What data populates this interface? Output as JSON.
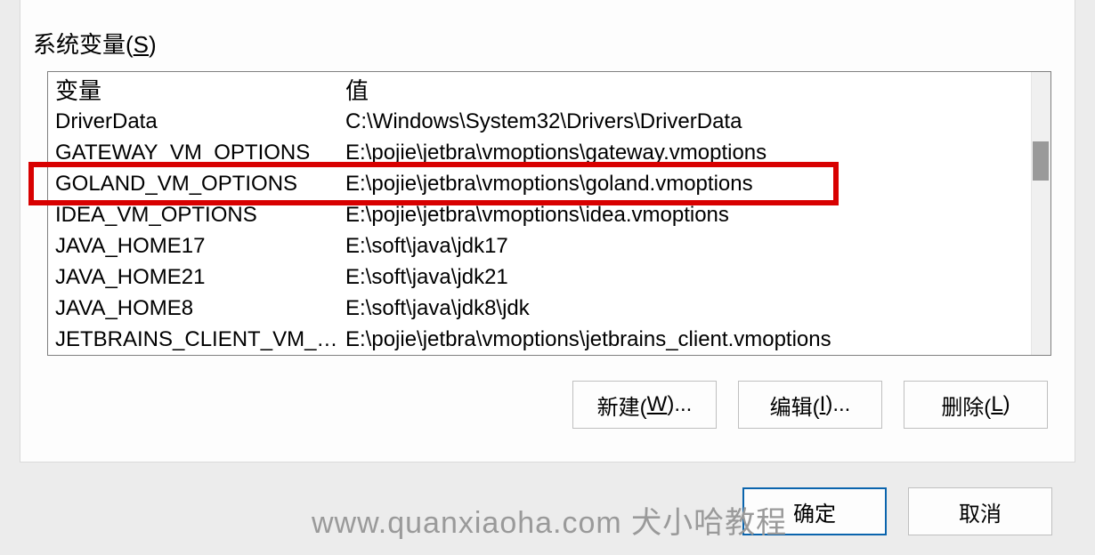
{
  "group": {
    "label_prefix": "系统变量(",
    "label_accel": "S",
    "label_suffix": ")"
  },
  "columns": {
    "variable": "变量",
    "value": "值"
  },
  "rows": [
    {
      "name": "DriverData",
      "value": "C:\\Windows\\System32\\Drivers\\DriverData"
    },
    {
      "name": "GATEWAY_VM_OPTIONS",
      "value": "E:\\pojie\\jetbra\\vmoptions\\gateway.vmoptions"
    },
    {
      "name": "GOLAND_VM_OPTIONS",
      "value": "E:\\pojie\\jetbra\\vmoptions\\goland.vmoptions"
    },
    {
      "name": "IDEA_VM_OPTIONS",
      "value": "E:\\pojie\\jetbra\\vmoptions\\idea.vmoptions"
    },
    {
      "name": "JAVA_HOME17",
      "value": "E:\\soft\\java\\jdk17"
    },
    {
      "name": "JAVA_HOME21",
      "value": "E:\\soft\\java\\jdk21"
    },
    {
      "name": "JAVA_HOME8",
      "value": "E:\\soft\\java\\jdk8\\jdk"
    },
    {
      "name": "JETBRAINS_CLIENT_VM_O...",
      "value": "E:\\pojie\\jetbra\\vmoptions\\jetbrains_client.vmoptions"
    }
  ],
  "highlight_row_index": 2,
  "buttons": {
    "new": {
      "pre": "新建(",
      "accel": "W",
      "post": ")..."
    },
    "edit": {
      "pre": "编辑(",
      "accel": "I",
      "post": ")..."
    },
    "delete": {
      "pre": "删除(",
      "accel": "L",
      "post": ")"
    },
    "ok": "确定",
    "cancel": "取消"
  },
  "watermark": "www.quanxiaoha.com 犬小哈教程"
}
